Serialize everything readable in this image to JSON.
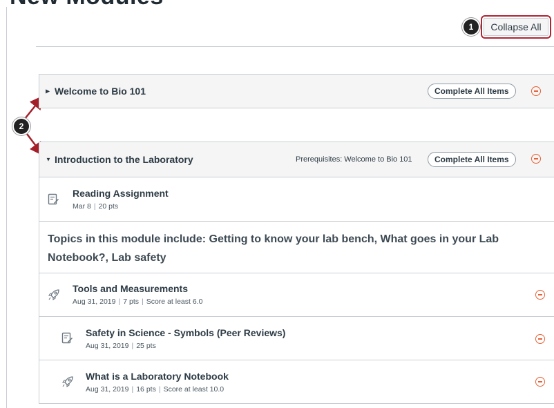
{
  "page": {
    "title_fragment": "New Modules"
  },
  "toolbar": {
    "collapse_all_label": "Collapse All"
  },
  "callouts": {
    "one": "1",
    "two": "2"
  },
  "modules": [
    {
      "title": "Welcome to Bio 101",
      "complete_label": "Complete All Items",
      "state": "collapsed"
    },
    {
      "title": "Introduction to the Laboratory",
      "prerequisites": "Prerequisites: Welcome to Bio 101",
      "complete_label": "Complete All Items",
      "state": "expanded"
    }
  ],
  "items": {
    "reading": {
      "title": "Reading Assignment",
      "date": "Mar 8",
      "points": "20 pts",
      "icon": "assignment-icon"
    },
    "topics_header": "Topics in this module include: Getting to know your lab bench, What goes in your Lab Notebook?, Lab safety",
    "tools": {
      "title": "Tools and Measurements",
      "date": "Aug 31, 2019",
      "points": "7 pts",
      "requirement": "Score at least 6.0",
      "icon": "quiz-rocket-icon"
    },
    "safety": {
      "title": "Safety in Science - Symbols (Peer Reviews)",
      "date": "Aug 31, 2019",
      "points": "25 pts",
      "icon": "assignment-icon"
    },
    "notebook": {
      "title": "What is a Laboratory Notebook",
      "date": "Aug 31, 2019",
      "points": "16 pts",
      "requirement": "Score at least 10.0",
      "icon": "quiz-rocket-icon"
    }
  },
  "colors": {
    "accent_red": "#b02533",
    "remove_orange": "#e66135",
    "header_bg": "#f5f5f5",
    "border": "#c7cdd1"
  }
}
